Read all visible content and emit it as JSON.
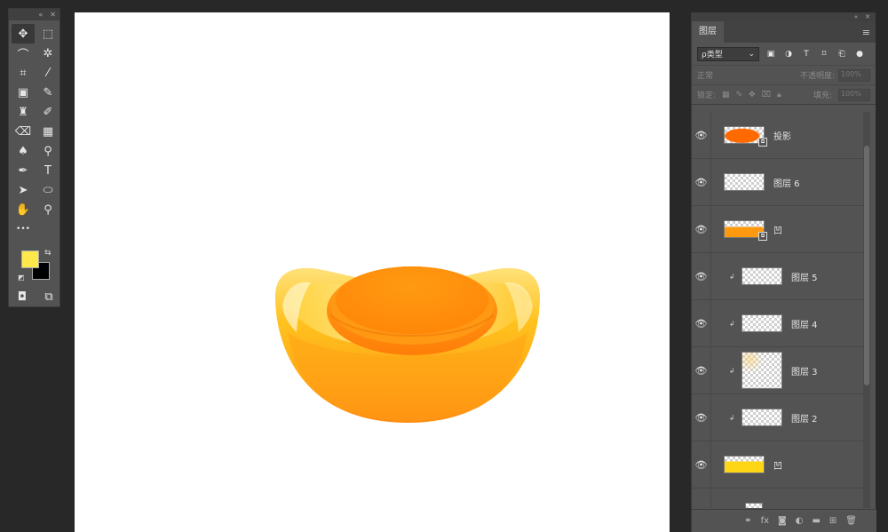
{
  "tools_panel": {
    "header_icons": [
      "collapse-icon",
      "close-icon"
    ],
    "tools": [
      {
        "name": "move-tool",
        "glyph": "✥",
        "active": true
      },
      {
        "name": "marquee-tool",
        "glyph": "⬚"
      },
      {
        "name": "lasso-tool",
        "glyph": "⌒"
      },
      {
        "name": "magic-wand-tool",
        "glyph": "✲"
      },
      {
        "name": "crop-tool",
        "glyph": "⌗"
      },
      {
        "name": "eyedropper-tool",
        "glyph": "⁄"
      },
      {
        "name": "healing-brush-tool",
        "glyph": "▣"
      },
      {
        "name": "brush-tool",
        "glyph": "✎"
      },
      {
        "name": "clone-stamp-tool",
        "glyph": "♜"
      },
      {
        "name": "history-brush-tool",
        "glyph": "✐"
      },
      {
        "name": "eraser-tool",
        "glyph": "⌫"
      },
      {
        "name": "gradient-tool",
        "glyph": "▦"
      },
      {
        "name": "blur-tool",
        "glyph": "♠"
      },
      {
        "name": "dodge-tool",
        "glyph": "⚲"
      },
      {
        "name": "pen-tool",
        "glyph": "✒"
      },
      {
        "name": "type-tool",
        "glyph": "T"
      },
      {
        "name": "path-selection-tool",
        "glyph": "➤"
      },
      {
        "name": "ellipse-tool",
        "glyph": "⬭"
      },
      {
        "name": "hand-tool",
        "glyph": "✋"
      },
      {
        "name": "zoom-tool",
        "glyph": "⚲"
      },
      {
        "name": "more-tools",
        "glyph": "•••"
      }
    ],
    "foreground_color": "#ffe84a",
    "background_color": "#000000"
  },
  "layers_panel": {
    "tab_label": "图层",
    "kind_filter": "ρ类型",
    "blend_mode": "正常",
    "opacity_label": "不透明度:",
    "opacity_value": "100%",
    "lock_label": "锁定:",
    "fill_label": "填充:",
    "fill_value": "100%",
    "layers": [
      {
        "name": "投影",
        "thumb": "orange-blob",
        "clipped": false,
        "smart": true
      },
      {
        "name": "图层 6",
        "thumb": "empty",
        "clipped": false,
        "smart": false
      },
      {
        "name": "凹",
        "thumb": "orange-half",
        "clipped": false,
        "smart": true
      },
      {
        "name": "图层 5",
        "thumb": "empty",
        "clipped": true,
        "smart": false
      },
      {
        "name": "图层 4",
        "thumb": "empty",
        "clipped": true,
        "smart": false
      },
      {
        "name": "图层 3",
        "thumb": "empty",
        "clipped": true,
        "smart": false,
        "tall": true
      },
      {
        "name": "图层 2",
        "thumb": "empty",
        "clipped": true,
        "smart": false
      },
      {
        "name": "凹",
        "thumb": "yellow-block",
        "clipped": false,
        "smart": false
      },
      {
        "name": "",
        "thumb": "empty",
        "clipped": false,
        "smart": false
      }
    ]
  },
  "colors": {
    "app_bg": "#282828",
    "panel_bg": "#535353",
    "canvas_bg": "#ffffff",
    "gold_light": "#ffd84a",
    "gold_dark": "#ff9a10",
    "dome": "#ff8f0d"
  }
}
